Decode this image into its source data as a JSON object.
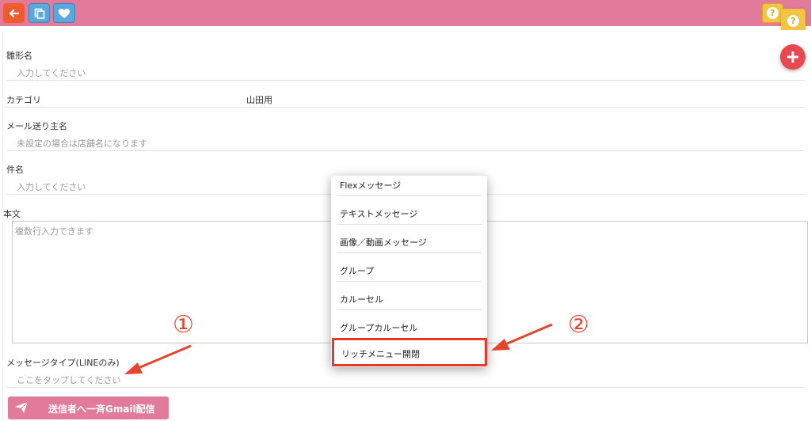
{
  "toolbar": {
    "icons": [
      "back-arrow-icon",
      "copy-icon",
      "heart-icon",
      "help-icon"
    ],
    "colors": {
      "bar": "#e27a9b",
      "back": "#ef5a2f",
      "copy": "#5aa8dc",
      "help": "#f4c542"
    }
  },
  "fab": {
    "add_icon": "plus-icon",
    "color": "#e8484f"
  },
  "form": {
    "template_name": {
      "label": "雛形名",
      "placeholder": "入力してください"
    },
    "category": {
      "label": "カテゴリ",
      "value": "山田用"
    },
    "sender_name": {
      "label": "メール送り主名",
      "placeholder": "未設定の場合は店舗名になります"
    },
    "subject": {
      "label": "件名",
      "placeholder": "入力してください"
    },
    "body": {
      "label": "本文",
      "placeholder": "複数行入力できます"
    },
    "message_type": {
      "label": "メッセージタイプ(LINEのみ)",
      "placeholder": "ここをタップしてください"
    }
  },
  "send_button": {
    "label": "送信者へ一斉Gmail配信",
    "icon": "paper-plane-icon"
  },
  "dropdown": {
    "items": [
      "Flexメッセージ",
      "テキストメッセージ",
      "画像／動画メッセージ",
      "グループ",
      "カルーセル",
      "グループカルーセル",
      "リッチメニュー開閉"
    ],
    "highlighted_index": 6
  },
  "annotations": {
    "marker1": "①",
    "marker2": "②",
    "color": "#e5452f"
  }
}
